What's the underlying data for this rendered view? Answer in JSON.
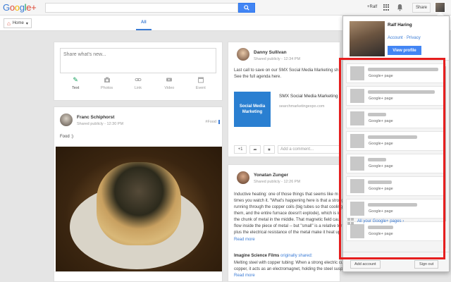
{
  "header": {
    "logo_text": "Google+",
    "search_placeholder": "",
    "plus_user": "+Ralf",
    "share_label": "Share"
  },
  "nav": {
    "home_label": "Home",
    "tab_all": "All"
  },
  "share_box": {
    "placeholder": "Share what's new...",
    "tools": [
      {
        "label": "Text",
        "icon": "pencil-icon"
      },
      {
        "label": "Photos",
        "icon": "camera-icon"
      },
      {
        "label": "Link",
        "icon": "link-icon"
      },
      {
        "label": "Video",
        "icon": "video-icon"
      },
      {
        "label": "Event",
        "icon": "calendar-icon"
      }
    ]
  },
  "posts": {
    "franc": {
      "name": "Franc Schiphorst",
      "meta": "Shared publicly  -  12:30 PM",
      "tag": "#Food",
      "text": "Food :)"
    },
    "danny": {
      "name": "Danny Sullivan",
      "meta": "Shared publicly  -  12:34 PM",
      "text1": "Last call to save on our SMX Social Media Marketing sh",
      "text2": "See the full agenda here.",
      "link_title": "SMX Social Media Marketing",
      "link_url": "searchmarketingexpo.com",
      "logo_text": "Social Media Marketing",
      "plus_count": "+1",
      "comment_placeholder": "Add a comment..."
    },
    "yonatan": {
      "name": "Yonatan Zunger",
      "meta": "Shared publicly  -  12:26 PM",
      "lines": [
        "Inductive heating: one of those things that seems like m",
        "times you watch it. \"What's happening here is that a strong",
        "running through the copper coils (big tubes so that cooling",
        "them, and the entire furnace doesn't explode), which is in",
        "the chunk of metal in the middle. That magnetic field cau",
        "flow inside the piece of metal -- but \"small\" is a relative ter",
        "plus the electrical resistance of the metal make it heat up"
      ],
      "read_more": "Read more",
      "reshare_source": "Imagine Science Films",
      "reshare_verb": "originally shared:",
      "reshare_lines": [
        "Melting steel with copper tubing: When a strong electric cu",
        "copper, it acts as an electromagnet, holding the steel suspe"
      ],
      "read_more2": "Read more"
    }
  },
  "account_menu": {
    "name": "Ralf Haring",
    "account_link": "Account",
    "privacy_link": "Privacy",
    "view_profile": "View profile",
    "pages": [
      {
        "label": "Google+ page"
      },
      {
        "label": "Google+ page"
      },
      {
        "label": "Google+ page"
      },
      {
        "label": "Google+ page"
      },
      {
        "label": "Google+ page"
      },
      {
        "label": "Google+ page"
      },
      {
        "label": "Google+ page"
      },
      {
        "label": "Google+ page"
      }
    ],
    "all_pages_link": "All your Google+ pages ›",
    "add_account": "Add account",
    "sign_out": "Sign out"
  },
  "colors": {
    "accent": "#4285f4",
    "highlight": "#e61e1e",
    "brand_red": "#dd4b39"
  }
}
